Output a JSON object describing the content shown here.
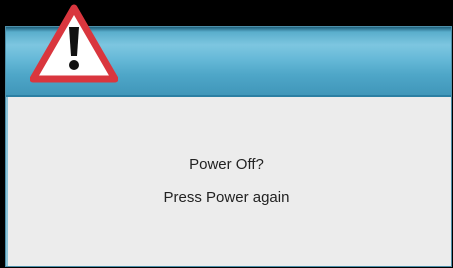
{
  "dialog": {
    "icon": "warning-triangle-icon",
    "message_line_1": "Power Off?",
    "message_line_2": "Press Power again"
  },
  "colors": {
    "header_accent": "#66b9d8",
    "body_background": "#ececec",
    "warning_red": "#d9363e",
    "background": "#000000"
  }
}
